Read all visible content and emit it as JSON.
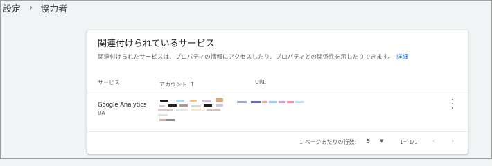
{
  "breadcrumb": {
    "parent": "設定",
    "separator": "›",
    "current": "協力者"
  },
  "card": {
    "title": "関連付けられているサービス",
    "description": "関連付けられたサービスは、プロパティの情報にアクセスしたり、プロパティとの関係性を示したりできます。",
    "details_link": "詳細",
    "columns": {
      "service": "サービス",
      "account": "アカウント",
      "url": "URL"
    },
    "rows": [
      {
        "service_name": "Google Analytics",
        "service_type": "UA"
      }
    ],
    "pagination": {
      "rows_per_page_label": "1 ページあたりの行数:",
      "rows_per_page_value": "5",
      "range": "1〜1/1"
    }
  },
  "colors": {
    "link": "#1a73e8",
    "background": "#f1f3f4",
    "card": "#ffffff"
  },
  "icons": {
    "sort": "arrow-up-icon",
    "more": "more-vert-icon",
    "dropdown": "caret-down-icon",
    "prev": "chevron-left-icon",
    "next": "chevron-right-icon"
  }
}
